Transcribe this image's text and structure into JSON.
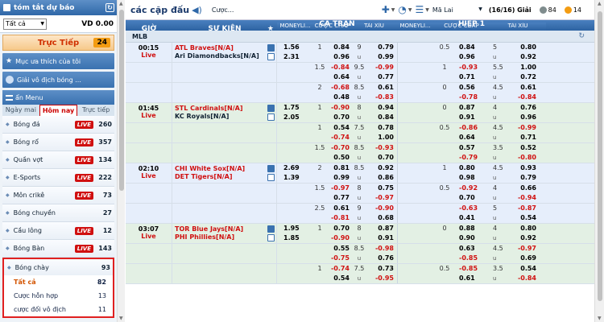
{
  "sidebar": {
    "summary_title": "tóm tắt dự báo",
    "filter_value": "Tất cả",
    "balance": "VD 0.00",
    "live_label": "Trực Tiếp",
    "live_count": "24",
    "favorites_label": "Mục ưa thích của tôi",
    "championship_label": "Giải vô địch bóng ...",
    "menu_label": "ẩn Menu",
    "tabs": [
      {
        "label": "Ngày mai"
      },
      {
        "label": "Hôm nay"
      },
      {
        "label": "Trực tiếp"
      }
    ],
    "live_tag": "LIVE",
    "sports": [
      {
        "name": "Bóng đá",
        "live": true,
        "count": "260"
      },
      {
        "name": "Bóng rổ",
        "live": true,
        "count": "357"
      },
      {
        "name": "Quần vợt",
        "live": true,
        "count": "134"
      },
      {
        "name": "E-Sports",
        "live": true,
        "count": "222"
      },
      {
        "name": "Môn crikê",
        "live": true,
        "count": "73"
      },
      {
        "name": "Bóng chuyền",
        "live": false,
        "count": "27"
      },
      {
        "name": "Cầu lông",
        "live": true,
        "count": "12"
      },
      {
        "name": "Bóng Bàn",
        "live": true,
        "count": "143"
      }
    ],
    "selected_sport": {
      "name": "Bóng chày",
      "count": "93"
    },
    "sub_items": [
      {
        "name": "Tất cả",
        "count": "82"
      },
      {
        "name": "Cược hỗn hợp",
        "count": "13"
      },
      {
        "name": "cược đối vô địch",
        "count": "11"
      }
    ]
  },
  "main": {
    "title": "các cặp đấu",
    "bet_label": "Cược...",
    "sort_value": "Mã Lai",
    "page_info": "(16/16)",
    "page_unit": "Giải",
    "count_a": "84",
    "count_b": "14",
    "colors": {
      "count_a_dot": "#7f8c8d",
      "count_b_dot": "#f39c12"
    },
    "header": {
      "time": "GIỜ",
      "event": "SỰ KIỆN",
      "full": "CẢ TRẬN",
      "half": "HIỆP 1",
      "moneyline": "MONEYLI...",
      "handicap": "CƯỢC CHẤP",
      "overunder": "TÀI XỈU"
    },
    "league": "MLB",
    "matches": [
      {
        "time": "00:15",
        "status": "Live",
        "team1": "ATL Braves[N/A]",
        "team2": "Ari Diamondbacks[N/A]",
        "team2_red": false,
        "color": "blue",
        "rows": [
          {
            "ml": [
              "1.56",
              "2.31"
            ],
            "hcl": [
              "1",
              ""
            ],
            "hco": [
              "0.84",
              "0.96"
            ],
            "oul": [
              "9",
              "u"
            ],
            "ouo": [
              "0.79",
              "0.99"
            ],
            "hcl2": [
              "0.5",
              ""
            ],
            "hco2": [
              "0.84",
              "0.96"
            ],
            "oul2": [
              "5",
              "u"
            ],
            "ouo2": [
              "0.80",
              "0.92"
            ]
          },
          {
            "ml": [
              "",
              ""
            ],
            "hcl": [
              "1.5",
              ""
            ],
            "hco": [
              "-0.84",
              "0.64"
            ],
            "oul": [
              "9.5",
              "u"
            ],
            "ouo": [
              "-0.99",
              "0.77"
            ],
            "hcl2": [
              "1",
              ""
            ],
            "hco2": [
              "-0.93",
              "0.71"
            ],
            "oul2": [
              "5.5",
              "u"
            ],
            "ouo2": [
              "1.00",
              "0.72"
            ]
          },
          {
            "ml": [
              "",
              ""
            ],
            "hcl": [
              "2",
              ""
            ],
            "hco": [
              "-0.68",
              "0.48"
            ],
            "oul": [
              "8.5",
              "u"
            ],
            "ouo": [
              "0.61",
              "-0.83"
            ],
            "hcl2": [
              "0",
              ""
            ],
            "hco2": [
              "0.56",
              "-0.78"
            ],
            "oul2": [
              "4.5",
              "u"
            ],
            "ouo2": [
              "0.61",
              "-0.84"
            ]
          }
        ]
      },
      {
        "time": "01:45",
        "status": "Live",
        "team1": "STL Cardinals[N/A]",
        "team2": "KC Royals[N/A]",
        "team2_red": false,
        "color": "green",
        "rows": [
          {
            "ml": [
              "1.75",
              "2.05"
            ],
            "hcl": [
              "1",
              ""
            ],
            "hco": [
              "-0.90",
              "0.70"
            ],
            "oul": [
              "8",
              "u"
            ],
            "ouo": [
              "0.94",
              "0.84"
            ],
            "hcl2": [
              "0",
              ""
            ],
            "hco2": [
              "0.87",
              "0.91"
            ],
            "oul2": [
              "4",
              "u"
            ],
            "ouo2": [
              "0.76",
              "0.96"
            ]
          },
          {
            "ml": [
              "",
              ""
            ],
            "hcl": [
              "",
              "1"
            ],
            "hco": [
              "0.54",
              "-0.74"
            ],
            "oul": [
              "7.5",
              "u"
            ],
            "ouo": [
              "0.78",
              "1.00"
            ],
            "hcl2": [
              "0.5",
              ""
            ],
            "hco2": [
              "-0.86",
              "0.64"
            ],
            "oul2": [
              "4.5",
              "u"
            ],
            "ouo2": [
              "-0.99",
              "0.71"
            ]
          },
          {
            "ml": [
              "",
              ""
            ],
            "hcl": [
              "1.5",
              ""
            ],
            "hco": [
              "-0.70",
              "0.50"
            ],
            "oul": [
              "8.5",
              "u"
            ],
            "ouo": [
              "-0.93",
              "0.70"
            ],
            "hcl2": [
              "",
              ""
            ],
            "hco2": [
              "0.57",
              "-0.79"
            ],
            "oul2": [
              "3.5",
              "u"
            ],
            "ouo2": [
              "0.52",
              "-0.80"
            ]
          }
        ]
      },
      {
        "time": "02:10",
        "status": "Live",
        "team1": "CHI White Sox[N/A]",
        "team2": "DET Tigers[N/A]",
        "team2_red": true,
        "color": "blue",
        "rows": [
          {
            "ml": [
              "2.69",
              "1.39"
            ],
            "hcl": [
              "",
              "2"
            ],
            "hco": [
              "0.81",
              "0.99"
            ],
            "oul": [
              "8.5",
              "u"
            ],
            "ouo": [
              "0.92",
              "0.86"
            ],
            "hcl2": [
              "",
              "1"
            ],
            "hco2": [
              "0.80",
              "0.98"
            ],
            "oul2": [
              "4.5",
              "u"
            ],
            "ouo2": [
              "0.93",
              "0.79"
            ]
          },
          {
            "ml": [
              "",
              ""
            ],
            "hcl": [
              "",
              "1.5"
            ],
            "hco": [
              "-0.97",
              "0.77"
            ],
            "oul": [
              "8",
              "u"
            ],
            "ouo": [
              "0.75",
              "-0.97"
            ],
            "hcl2": [
              "",
              "0.5"
            ],
            "hco2": [
              "-0.92",
              "0.70"
            ],
            "oul2": [
              "4",
              "u"
            ],
            "ouo2": [
              "0.66",
              "-0.94"
            ]
          },
          {
            "ml": [
              "",
              ""
            ],
            "hcl": [
              "",
              "2.5"
            ],
            "hco": [
              "0.61",
              "-0.81"
            ],
            "oul": [
              "9",
              "u"
            ],
            "ouo": [
              "-0.90",
              "0.68"
            ],
            "hcl2": [
              "",
              ""
            ],
            "hco2": [
              "-0.63",
              "0.41"
            ],
            "oul2": [
              "5",
              "u"
            ],
            "ouo2": [
              "-0.87",
              "0.54"
            ]
          }
        ]
      },
      {
        "time": "03:07",
        "status": "Live",
        "team1": "TOR Blue Jays[N/A]",
        "team2": "PHI Phillies[N/A]",
        "team2_red": true,
        "color": "green",
        "rows": [
          {
            "ml": [
              "1.95",
              "1.85"
            ],
            "hcl": [
              "",
              "1"
            ],
            "hco": [
              "0.70",
              "-0.90"
            ],
            "oul": [
              "8",
              "u"
            ],
            "ouo": [
              "0.87",
              "0.91"
            ],
            "hcl2": [
              "0",
              ""
            ],
            "hco2": [
              "0.88",
              "0.90"
            ],
            "oul2": [
              "4",
              "u"
            ],
            "ouo2": [
              "0.80",
              "0.92"
            ]
          },
          {
            "ml": [
              "",
              ""
            ],
            "hcl": [
              "",
              ""
            ],
            "hco": [
              "0.55",
              "-0.75"
            ],
            "oul": [
              "8.5",
              "u"
            ],
            "ouo": [
              "-0.98",
              "0.76"
            ],
            "hcl2": [
              "",
              ""
            ],
            "hco2": [
              "0.63",
              "-0.85"
            ],
            "oul2": [
              "4.5",
              "u"
            ],
            "ouo2": [
              "-0.97",
              "0.69"
            ]
          },
          {
            "ml": [
              "",
              ""
            ],
            "hcl": [
              "",
              "1"
            ],
            "hco": [
              "-0.74",
              "0.54"
            ],
            "oul": [
              "7.5",
              "u"
            ],
            "ouo": [
              "0.73",
              "-0.95"
            ],
            "hcl2": [
              "0.5",
              ""
            ],
            "hco2": [
              "-0.85",
              "0.61"
            ],
            "oul2": [
              "3.5",
              "u"
            ],
            "ouo2": [
              "0.54",
              "-0.84"
            ]
          }
        ]
      }
    ]
  }
}
